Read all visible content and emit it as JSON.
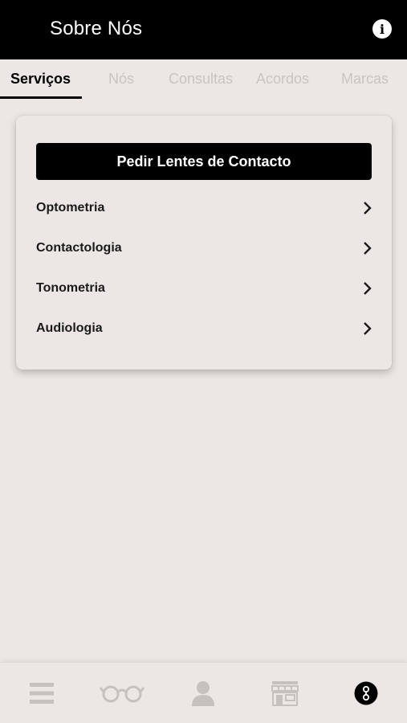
{
  "header": {
    "title": "Sobre Nós",
    "info_icon": "info-icon"
  },
  "tabs": [
    {
      "label": "Serviços",
      "active": true
    },
    {
      "label": "Nós",
      "active": false
    },
    {
      "label": "Consultas",
      "active": false
    },
    {
      "label": "Acordos",
      "active": false
    },
    {
      "label": "Marcas",
      "active": false
    }
  ],
  "services": {
    "cta_label": "Pedir Lentes de Contacto",
    "items": [
      {
        "label": "Optometria"
      },
      {
        "label": "Contactologia"
      },
      {
        "label": "Tonometria"
      },
      {
        "label": "Audiologia"
      }
    ]
  },
  "bottom_nav": {
    "items": [
      {
        "icon": "menu-icon",
        "active": false
      },
      {
        "icon": "glasses-icon",
        "active": false
      },
      {
        "icon": "user-icon",
        "active": false
      },
      {
        "icon": "store-icon",
        "active": false
      },
      {
        "icon": "about-icon",
        "active": true
      }
    ]
  },
  "colors": {
    "header_bg": "#000000",
    "page_bg": "#ece7e4",
    "inactive_tab": "#c8c4c1",
    "inactive_icon": "#c6c1be"
  }
}
